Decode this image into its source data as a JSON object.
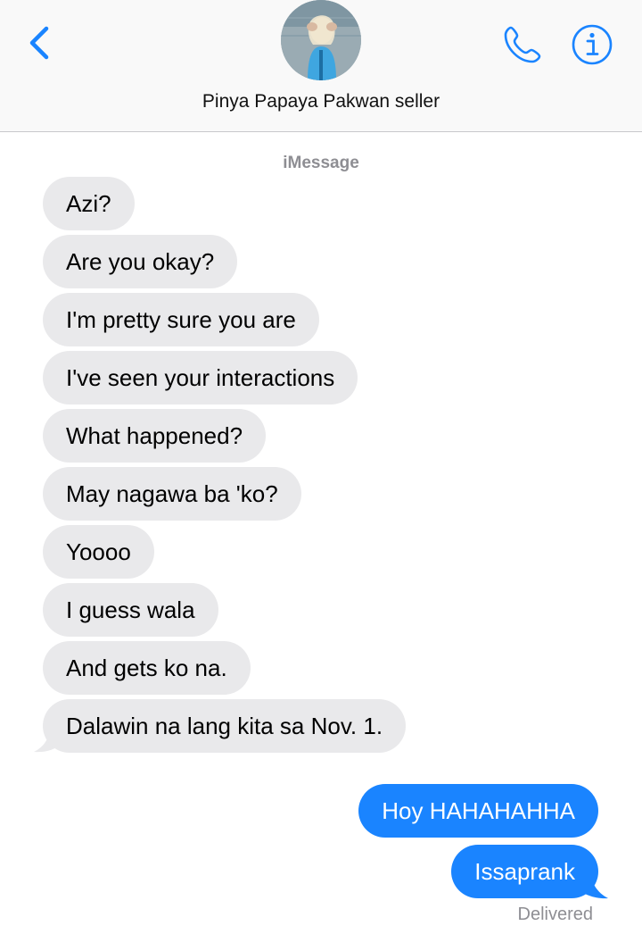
{
  "header": {
    "contact_name": "Pinya Papaya Pakwan seller",
    "avatar_alt": "contact photo",
    "accent_color": "#1a84ff"
  },
  "icons": {
    "back": "chevron-left-icon",
    "call": "phone-icon",
    "info": "info-icon"
  },
  "conversation": {
    "service_label": "iMessage",
    "incoming": [
      "Azi?",
      "Are you okay?",
      "I'm pretty sure you are",
      "I've seen your interactions",
      "What happened?",
      "May nagawa ba 'ko?",
      "Yoooo",
      "I guess wala",
      "And gets ko na.",
      "Dalawin na lang kita sa Nov. 1."
    ],
    "outgoing": [
      "Hoy HAHAHAHHA",
      "Issaprank"
    ],
    "status": "Delivered"
  },
  "colors": {
    "incoming_bubble": "#e9e9eb",
    "outgoing_bubble": "#1a84ff"
  }
}
